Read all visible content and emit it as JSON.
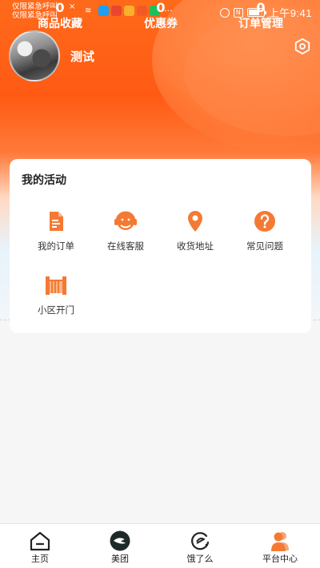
{
  "status_bar": {
    "emergency_line1": "仅限紧急呼叫",
    "emergency_line2": "仅限紧急呼叫",
    "close_mark": "×",
    "wifi_glyph": "≋",
    "more_dots": "···",
    "nfc": "N",
    "battery_text": "",
    "time": "上午9:41",
    "app_icon_colors": [
      "#1aa0f5",
      "#e8472f",
      "#f7b12c",
      "#f15a24",
      "#1fbf5c"
    ]
  },
  "profile": {
    "username": "测试",
    "settings_icon": "hexagon-settings-icon"
  },
  "stats": [
    {
      "value": "0",
      "label": "商品收藏"
    },
    {
      "value": "0",
      "label": "优惠券"
    },
    {
      "value": "0",
      "label": "订单管理"
    }
  ],
  "activity": {
    "title": "我的活动",
    "items": [
      {
        "label": "我的订单",
        "icon": "order-icon"
      },
      {
        "label": "在线客服",
        "icon": "headset-icon"
      },
      {
        "label": "收货地址",
        "icon": "location-pin-icon"
      },
      {
        "label": "常见问题",
        "icon": "question-icon"
      },
      {
        "label": "小区开门",
        "icon": "gate-icon"
      }
    ]
  },
  "bottom_nav": [
    {
      "label": "主页",
      "icon": "home-icon"
    },
    {
      "label": "美团",
      "icon": "meituan-icon"
    },
    {
      "label": "饿了么",
      "icon": "eleme-icon"
    },
    {
      "label": "平台中心",
      "icon": "platform-user-icon"
    }
  ],
  "colors": {
    "accent": "#ff6a1a",
    "accent_icon": "#f47a34",
    "text_dark": "#222222",
    "card_bg": "#ffffff",
    "page_bg": "#f6f6f6"
  }
}
